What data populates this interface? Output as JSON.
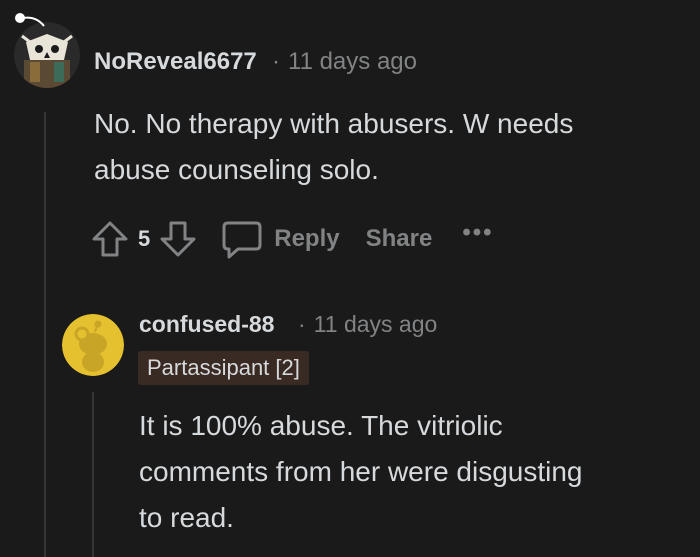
{
  "comment": {
    "username": "NoReveal6677",
    "time": "11 days ago",
    "separator": "·",
    "body_lines": [
      "No. No therapy with abusers. W needs",
      "abuse counseling solo."
    ],
    "score": "5",
    "reply_label": "Reply",
    "share_label": "Share",
    "more_label": "•••"
  },
  "reply": {
    "username": "confused-88",
    "time": "11 days ago",
    "separator": "·",
    "flair": "Partassipant [2]",
    "body_lines": [
      "It is 100% abuse. The vitriolic",
      "comments from her were disgusting",
      "to read."
    ]
  },
  "colors": {
    "background": "#1a1a1b",
    "text": "#d7dadc",
    "muted": "#818384",
    "thread_line": "#343536",
    "flair_bg": "#3a2a24",
    "snoo_avatar_bg": "#e6c12f"
  },
  "icons": {
    "upvote": "arrow-up-icon",
    "downvote": "arrow-down-icon",
    "reply": "speech-bubble-icon",
    "more": "ellipsis-icon"
  }
}
